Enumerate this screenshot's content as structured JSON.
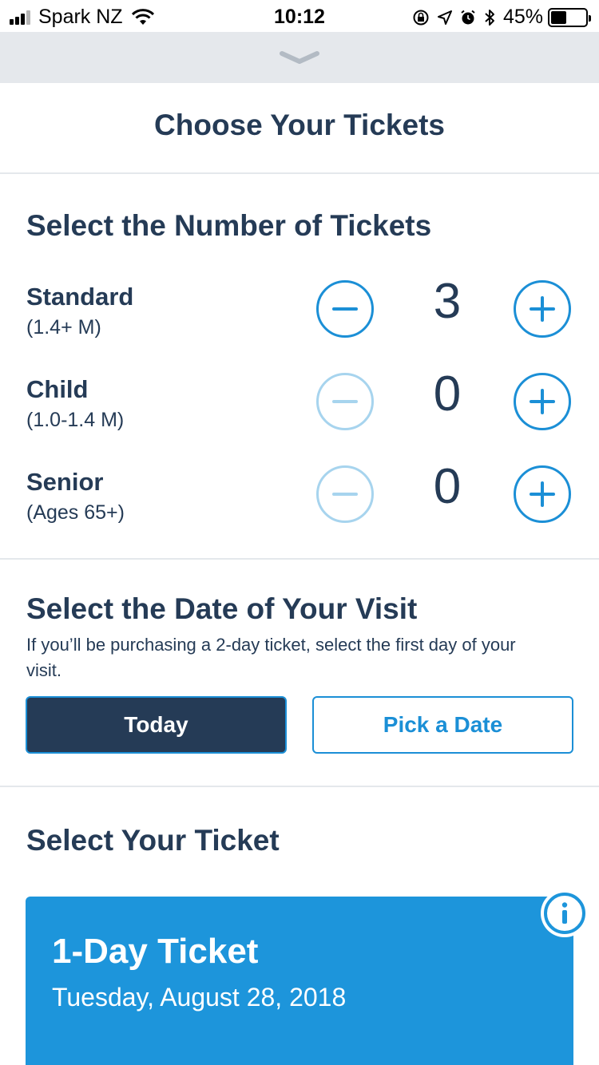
{
  "status_bar": {
    "carrier": "Spark NZ",
    "time": "10:12",
    "battery": "45%",
    "battery_level": 0.45,
    "icons": [
      "signal-icon",
      "wifi-icon",
      "orientation-lock-icon",
      "location-icon",
      "alarm-icon",
      "bluetooth-icon",
      "battery-icon"
    ]
  },
  "sheet": {
    "handle_icon": "chevron-down-icon"
  },
  "header": {
    "title": "Choose Your Tickets"
  },
  "number_section": {
    "title": "Select the Number of Tickets",
    "rows": [
      {
        "label": "Standard",
        "sub": "(1.4+ M)",
        "count": "3",
        "minus_enabled": true
      },
      {
        "label": "Child",
        "sub": "(1.0-1.4 M)",
        "count": "0",
        "minus_enabled": false
      },
      {
        "label": "Senior",
        "sub": "(Ages 65+)",
        "count": "0",
        "minus_enabled": false
      }
    ]
  },
  "date_section": {
    "title": "Select the Date of Your Visit",
    "note": "If you’ll be purchasing a 2-day ticket, select the first day of your visit.",
    "today_label": "Today",
    "pick_label": "Pick a Date"
  },
  "ticket_section": {
    "title": "Select Your Ticket",
    "card": {
      "title": "1-Day Ticket",
      "date": "Tuesday, August 28, 2018",
      "info_icon": "info-icon"
    }
  },
  "colors": {
    "navy": "#253b56",
    "accent": "#1b8fd6",
    "card": "#1d95db",
    "disabled": "#a7d4ee"
  }
}
